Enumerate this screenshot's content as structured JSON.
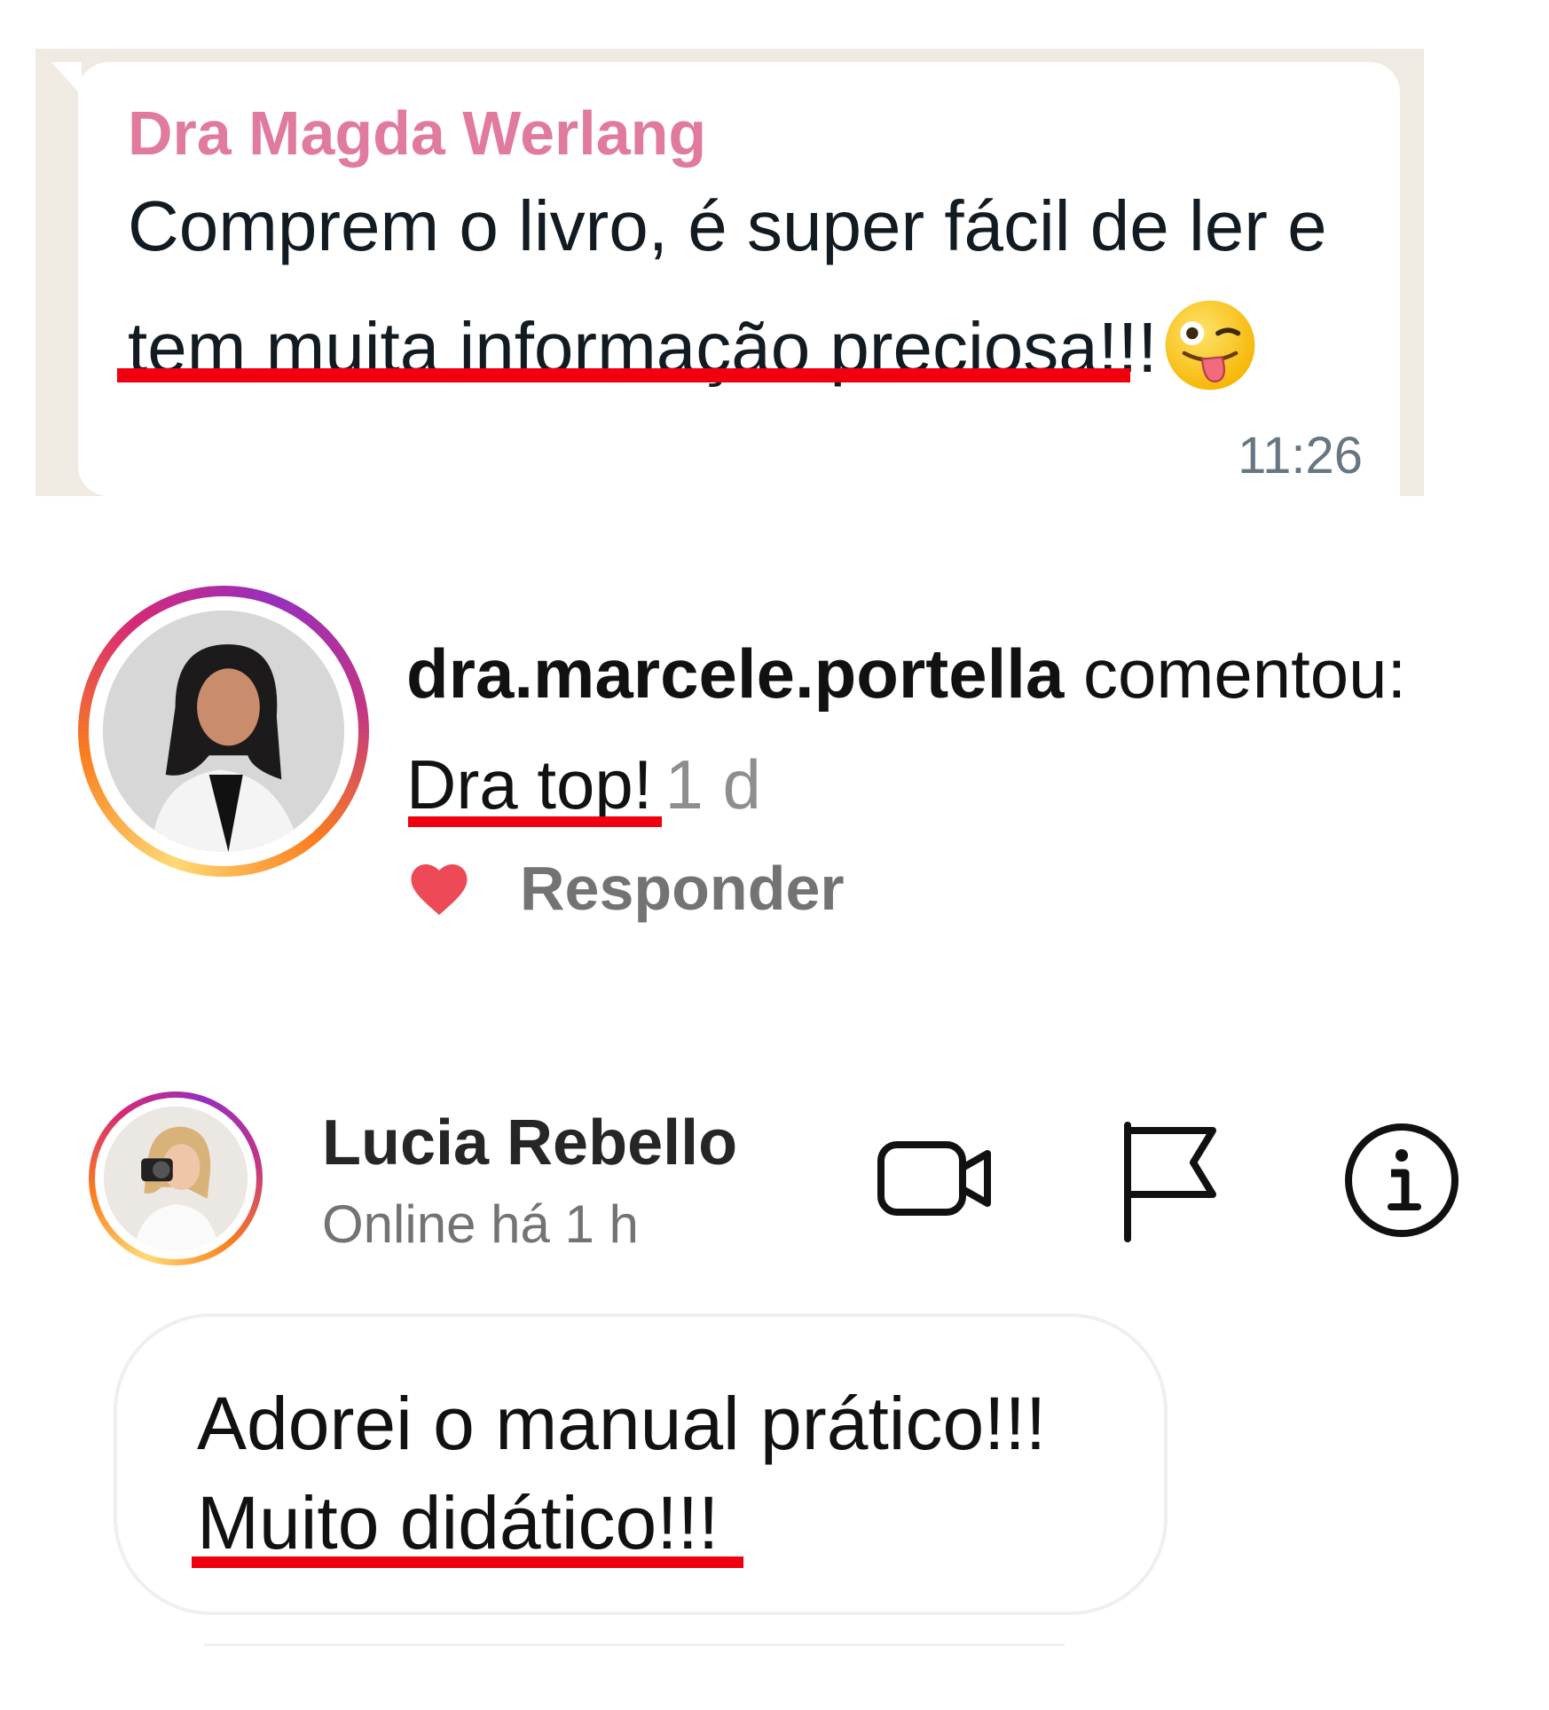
{
  "whatsapp": {
    "sender": "Dra Magda Werlang",
    "line1": "Comprem o livro, é super fácil de ler e",
    "line2": "tem muita informação preciosa!!!",
    "emoji": "winking-face-with-tongue",
    "time": "11:26"
  },
  "comment": {
    "username": "dra.marcele.portella",
    "action": " comentou:",
    "text": "Dra top!",
    "time": "1 d",
    "reply_label": "Responder",
    "like_color": "#ed4956"
  },
  "dm": {
    "name": "Lucia Rebello",
    "status": "Online há 1 h",
    "icons": [
      "video-call-icon",
      "flag-icon",
      "info-icon"
    ],
    "message_line1": "Adorei o manual prático!!!",
    "message_line2": "Muito didático!!!"
  },
  "colors": {
    "highlight_underline": "#f0000f",
    "whatsapp_sender": "#e07a9f",
    "whatsapp_background": "#efeae2"
  }
}
